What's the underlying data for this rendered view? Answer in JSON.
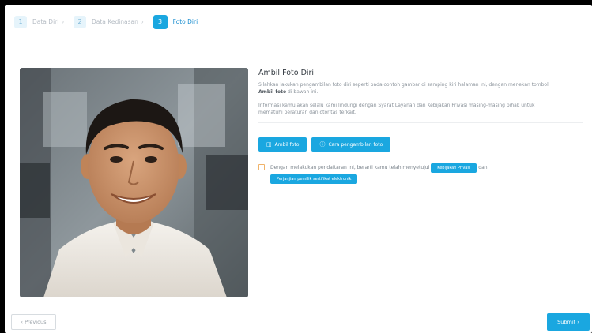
{
  "stepper": {
    "steps": [
      {
        "num": "1",
        "label": "Data Diri",
        "state": "inactive"
      },
      {
        "num": "2",
        "label": "Data Kedinasan",
        "state": "inactive"
      },
      {
        "num": "3",
        "label": "Foto Diri",
        "state": "active"
      }
    ]
  },
  "photo": {
    "icon": "person-photo"
  },
  "panel": {
    "title": "Ambil Foto Diri",
    "desc_before": "Silahkan lakukan pengambilan foto diri seperti pada contoh gambar di samping kiri halaman ini, dengan menekan tombol ",
    "desc_bold": "Ambil foto",
    "desc_after": " di bawah ini.",
    "desc2": "Informasi kamu akan selalu kami lindungi dengan Syarat Layanan dan Kebijakan Privasi masing-masing pihak untuk mematuhi peraturan dan otoritas terkait.",
    "take_photo_label": "Ambil foto",
    "how_to_label": "Cara pengambilan foto",
    "agree_text": "Dengan melakukan pendaftaran ini, berarti kamu telah menyetujui",
    "privacy_chip": "Kebijakan Privasi",
    "and_text": "dan",
    "agreement_chip": "Perjanjian pemilik sertifikat elektronik"
  },
  "footer": {
    "prev_label": "‹ Previous",
    "submit_label": "Submit ›"
  },
  "colors": {
    "accent": "#1aa7e0",
    "checkbox_border": "#f0b36a"
  }
}
